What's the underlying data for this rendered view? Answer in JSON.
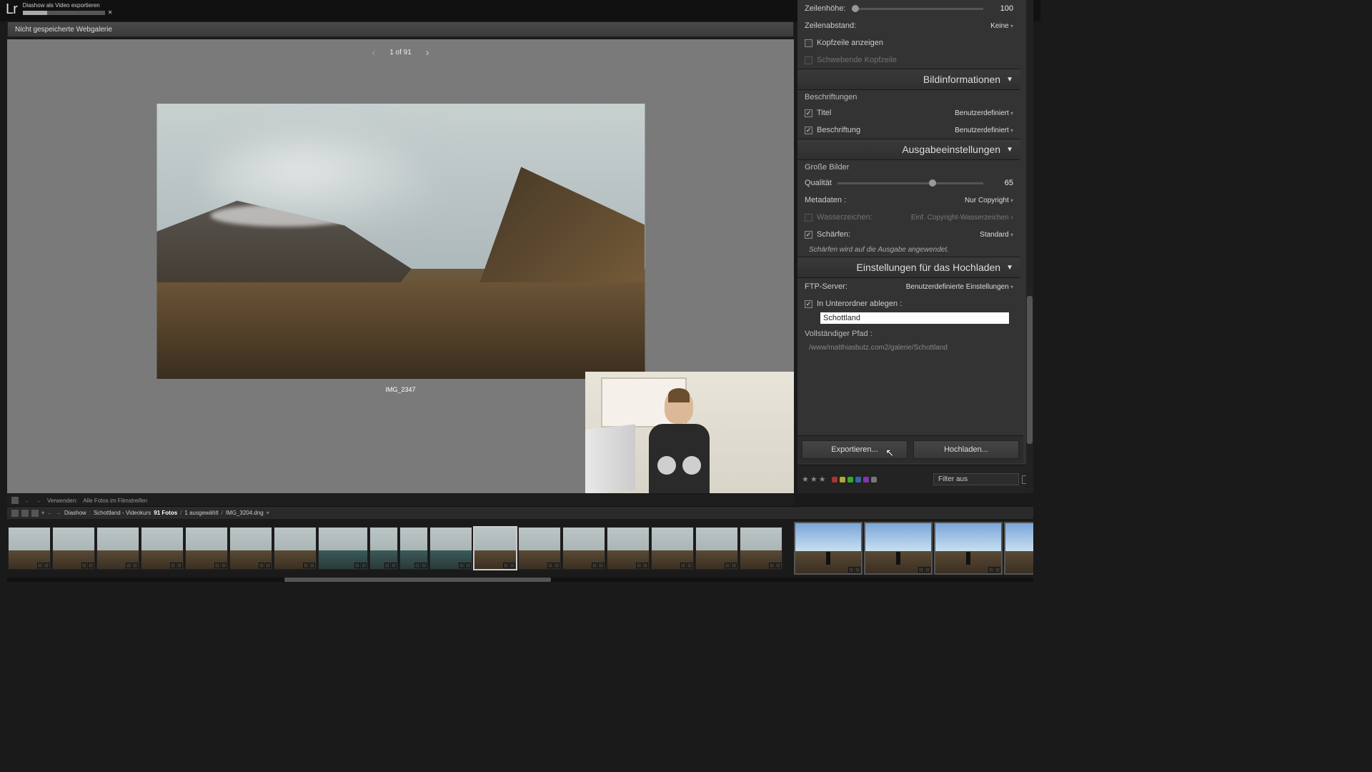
{
  "top": {
    "logo": "Lr",
    "export_status": "Diashow als Video exportieren"
  },
  "gallery_bar": {
    "title": "Nicht gespeicherte Webgalerie"
  },
  "pager": {
    "label": "1 of 91"
  },
  "preview": {
    "caption": "IMG_2347"
  },
  "panels": {
    "row_height_label": "Zeilenhöhe:",
    "row_height_value": "100",
    "row_spacing_label": "Zeilenabstand:",
    "row_spacing_value": "Keine",
    "show_header": "Kopfzeile anzeigen",
    "floating_header": "Schwebende Kopfzeile",
    "bildinfo": {
      "title": "Bildinformationen",
      "beschriftungen": "Beschriftungen",
      "titel": "Titel",
      "titel_val": "Benutzerdefiniert",
      "beschriftung": "Beschriftung",
      "beschriftung_val": "Benutzerdefiniert"
    },
    "ausgabe": {
      "title": "Ausgabeeinstellungen",
      "grosse": "Große Bilder",
      "qualitat": "Qualität",
      "qualitat_val": "65",
      "metadaten": "Metadaten :",
      "metadaten_val": "Nur Copyright",
      "wasserzeichen": "Wasserzeichen:",
      "wasserzeichen_val": "Einf. Copyright-Wasserzeichen",
      "scharfen": "Schärfen:",
      "scharfen_val": "Standard",
      "scharfen_note": "Schärfen wird auf die Ausgabe angewendet."
    },
    "hochladen": {
      "title": "Einstellungen für das Hochladen",
      "ftp": "FTP-Server:",
      "ftp_val": "Benutzerdefinierte Einstellungen",
      "subfolder": "In Unterordner ablegen :",
      "subfolder_val": "Schottland",
      "fullpath_label": "Vollständiger Pfad :",
      "fullpath": "/www/matthiasbutz.com2/galerie/Schottland"
    }
  },
  "actions": {
    "export": "Exportieren...",
    "upload": "Hochladen..."
  },
  "filter": {
    "label": "Filter aus"
  },
  "source_bar": {
    "verwenden": "Verwenden:",
    "label": "Alle Fotos im Filmstreifen"
  },
  "crumb": {
    "a": "Diashow",
    "b": "Schottland - Videokurs",
    "count": "91 Fotos",
    "sel": "1 ausgewählt",
    "file": "IMG_3204.dng"
  }
}
